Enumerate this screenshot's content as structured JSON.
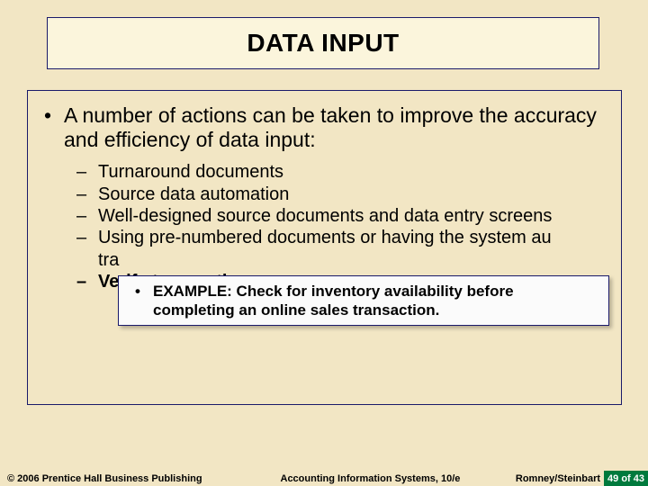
{
  "title": "DATA INPUT",
  "main_bullet": "A number of actions can be taken to improve the accuracy and efficiency of data input:",
  "sub_items": [
    {
      "text": "Turnaround documents",
      "bold": false
    },
    {
      "text": "Source data automation",
      "bold": false
    },
    {
      "text": "Well-designed source documents and data entry screens",
      "bold": false
    },
    {
      "text": "Using pre-numbered documents or having the system au\ntra",
      "bold": false
    },
    {
      "text": "Verify transactions",
      "bold": true
    }
  ],
  "example": "EXAMPLE:  Check for inventory availability before completing an online sales transaction.",
  "footer": {
    "left": "© 2006 Prentice Hall Business Publishing",
    "center": "Accounting Information Systems, 10/e",
    "right": "Romney/Steinbart",
    "page": "49 of 43"
  }
}
